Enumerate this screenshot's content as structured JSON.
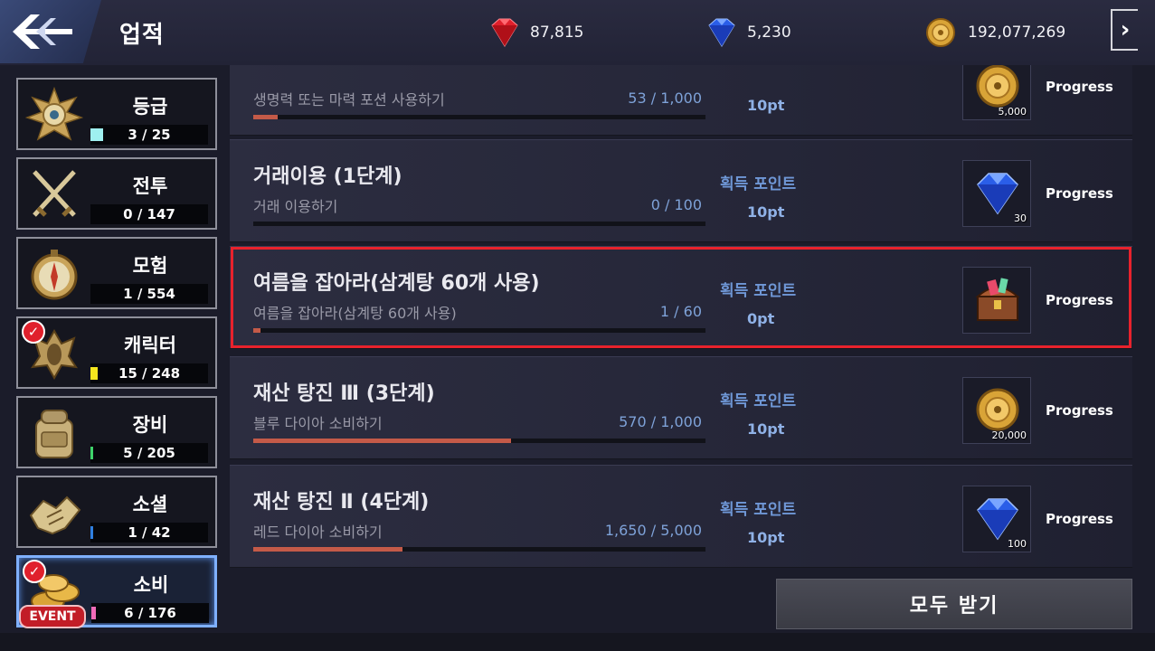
{
  "header": {
    "title": "업적",
    "currencies": [
      {
        "name": "red-diamond",
        "value": "87,815",
        "color": "#e0202c"
      },
      {
        "name": "blue-diamond",
        "value": "5,230",
        "color": "#2a5ee8"
      },
      {
        "name": "gold-coin",
        "value": "192,077,269",
        "color": "#d9a437"
      }
    ]
  },
  "sidebar": {
    "categories": [
      {
        "label": "등급",
        "count": "3 / 25",
        "bar_color": "#9ff0f0",
        "icon": "emblem-icon"
      },
      {
        "label": "전투",
        "count": "0 / 147",
        "bar_color": "#1a1a1a",
        "icon": "crossed-swords-icon"
      },
      {
        "label": "모험",
        "count": "1 / 554",
        "bar_color": "#1a1a1a",
        "icon": "compass-icon"
      },
      {
        "label": "캐릭터",
        "count": "15 / 248",
        "bar_color": "#f5e61e",
        "icon": "helmet-icon",
        "badge": "✓"
      },
      {
        "label": "장비",
        "count": "5 / 205",
        "bar_color": "#3ed36a",
        "icon": "backpack-icon"
      },
      {
        "label": "소셜",
        "count": "1 / 42",
        "bar_color": "#2f7fe0",
        "icon": "handshake-icon"
      },
      {
        "label": "소비",
        "count": "6 / 176",
        "bar_color": "#f06bb8",
        "icon": "coins-icon",
        "badge": "✓",
        "event": "EVENT",
        "selected": true
      }
    ]
  },
  "achievements": [
    {
      "title": "",
      "desc": "생명력 또는 마력 포션 사용하기",
      "progress": "53 / 1,000",
      "fraction": 0.053,
      "points_label": "",
      "points": "10pt",
      "reward_icon": "gold-coin-icon",
      "reward_count": "5,000",
      "status": "Progress"
    },
    {
      "title": "거래이용 (1단계)",
      "desc": "거래 이용하기",
      "progress": "0 / 100",
      "fraction": 0,
      "points_label": "획득 포인트",
      "points": "10pt",
      "reward_icon": "blue-diamond-icon",
      "reward_count": "30",
      "status": "Progress"
    },
    {
      "title": "여름을 잡아라(삼계탕 60개 사용)",
      "desc": "여름을 잡아라(삼계탕 60개 사용)",
      "progress": "1 / 60",
      "fraction": 0.0167,
      "points_label": "획득 포인트",
      "points": "0pt",
      "reward_icon": "treasure-chest-icon",
      "reward_count": "",
      "status": "Progress",
      "highlight": true
    },
    {
      "title": "재산 탕진 Ⅲ (3단계)",
      "desc": "블루 다이아 소비하기",
      "progress": "570 / 1,000",
      "fraction": 0.57,
      "points_label": "획득 포인트",
      "points": "10pt",
      "reward_icon": "gold-coin-icon",
      "reward_count": "20,000",
      "status": "Progress"
    },
    {
      "title": "재산 탕진 Ⅱ (4단계)",
      "desc": "레드 다이아 소비하기",
      "progress": "1,650 / 5,000",
      "fraction": 0.33,
      "points_label": "획득 포인트",
      "points": "10pt",
      "reward_icon": "blue-diamond-icon",
      "reward_count": "100",
      "status": "Progress"
    }
  ],
  "claim_all_label": "모두 받기"
}
